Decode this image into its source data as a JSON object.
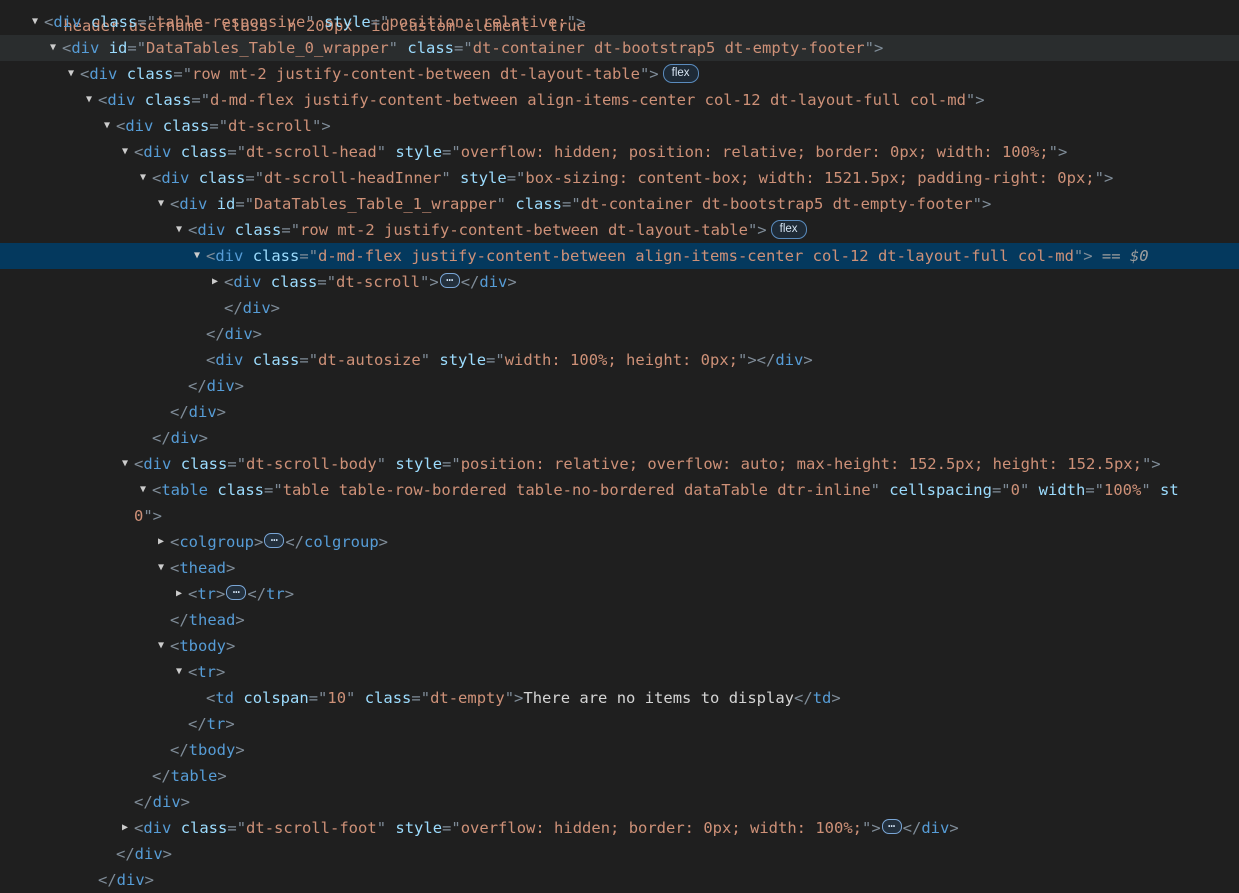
{
  "top_partial": "header.username  class  h 200px  id custom-element  true",
  "selected_marker": "$0",
  "selected_eq": "==",
  "badge_label": "flex",
  "ellipsis_label": "…",
  "lines": [
    {
      "depth": 1,
      "tw": "open",
      "parts": [
        [
          "p",
          "<"
        ],
        [
          "t",
          "div"
        ],
        [
          "sp",
          " "
        ],
        [
          "a",
          "class"
        ],
        [
          "p",
          "=\""
        ],
        [
          "v",
          "table-responsive"
        ],
        [
          "p",
          "\""
        ],
        [
          "sp",
          " "
        ],
        [
          "a",
          "style"
        ],
        [
          "p",
          "=\""
        ],
        [
          "v",
          "position: relative;"
        ],
        [
          "p",
          "\">"
        ]
      ]
    },
    {
      "depth": 2,
      "tw": "open",
      "state": "hover",
      "parts": [
        [
          "p",
          "<"
        ],
        [
          "t",
          "div"
        ],
        [
          "sp",
          " "
        ],
        [
          "a",
          "id"
        ],
        [
          "p",
          "=\""
        ],
        [
          "v",
          "DataTables_Table_0_wrapper"
        ],
        [
          "p",
          "\""
        ],
        [
          "sp",
          " "
        ],
        [
          "a",
          "class"
        ],
        [
          "p",
          "=\""
        ],
        [
          "v",
          "dt-container dt-bootstrap5 dt-empty-footer"
        ],
        [
          "p",
          "\">"
        ]
      ]
    },
    {
      "depth": 3,
      "tw": "open",
      "parts": [
        [
          "p",
          "<"
        ],
        [
          "t",
          "div"
        ],
        [
          "sp",
          " "
        ],
        [
          "a",
          "class"
        ],
        [
          "p",
          "=\""
        ],
        [
          "v",
          "row mt-2 justify-content-between dt-layout-table"
        ],
        [
          "p",
          "\">"
        ],
        [
          "badge",
          "flex"
        ]
      ]
    },
    {
      "depth": 4,
      "tw": "open",
      "parts": [
        [
          "p",
          "<"
        ],
        [
          "t",
          "div"
        ],
        [
          "sp",
          " "
        ],
        [
          "a",
          "class"
        ],
        [
          "p",
          "=\""
        ],
        [
          "v",
          "d-md-flex justify-content-between align-items-center col-12 dt-layout-full col-md"
        ],
        [
          "p",
          "\">"
        ]
      ]
    },
    {
      "depth": 5,
      "tw": "open",
      "parts": [
        [
          "p",
          "<"
        ],
        [
          "t",
          "div"
        ],
        [
          "sp",
          " "
        ],
        [
          "a",
          "class"
        ],
        [
          "p",
          "=\""
        ],
        [
          "v",
          "dt-scroll"
        ],
        [
          "p",
          "\">"
        ]
      ]
    },
    {
      "depth": 6,
      "tw": "open",
      "parts": [
        [
          "p",
          "<"
        ],
        [
          "t",
          "div"
        ],
        [
          "sp",
          " "
        ],
        [
          "a",
          "class"
        ],
        [
          "p",
          "=\""
        ],
        [
          "v",
          "dt-scroll-head"
        ],
        [
          "p",
          "\""
        ],
        [
          "sp",
          " "
        ],
        [
          "a",
          "style"
        ],
        [
          "p",
          "=\""
        ],
        [
          "v",
          "overflow: hidden; position: relative; border: 0px; width: 100%;"
        ],
        [
          "p",
          "\">"
        ]
      ]
    },
    {
      "depth": 7,
      "tw": "open",
      "parts": [
        [
          "p",
          "<"
        ],
        [
          "t",
          "div"
        ],
        [
          "sp",
          " "
        ],
        [
          "a",
          "class"
        ],
        [
          "p",
          "=\""
        ],
        [
          "v",
          "dt-scroll-headInner"
        ],
        [
          "p",
          "\""
        ],
        [
          "sp",
          " "
        ],
        [
          "a",
          "style"
        ],
        [
          "p",
          "=\""
        ],
        [
          "v",
          "box-sizing: content-box; width: 1521.5px; padding-right: 0px;"
        ],
        [
          "p",
          "\">"
        ]
      ]
    },
    {
      "depth": 8,
      "tw": "open",
      "parts": [
        [
          "p",
          "<"
        ],
        [
          "t",
          "div"
        ],
        [
          "sp",
          " "
        ],
        [
          "a",
          "id"
        ],
        [
          "p",
          "=\""
        ],
        [
          "v",
          "DataTables_Table_1_wrapper"
        ],
        [
          "p",
          "\""
        ],
        [
          "sp",
          " "
        ],
        [
          "a",
          "class"
        ],
        [
          "p",
          "=\""
        ],
        [
          "v",
          "dt-container dt-bootstrap5 dt-empty-footer"
        ],
        [
          "p",
          "\">"
        ]
      ]
    },
    {
      "depth": 9,
      "tw": "open",
      "parts": [
        [
          "p",
          "<"
        ],
        [
          "t",
          "div"
        ],
        [
          "sp",
          " "
        ],
        [
          "a",
          "class"
        ],
        [
          "p",
          "=\""
        ],
        [
          "v",
          "row mt-2 justify-content-between dt-layout-table"
        ],
        [
          "p",
          "\">"
        ],
        [
          "badge",
          "flex"
        ]
      ]
    },
    {
      "depth": 10,
      "tw": "open",
      "state": "selected",
      "parts": [
        [
          "p",
          "<"
        ],
        [
          "t",
          "div"
        ],
        [
          "sp",
          " "
        ],
        [
          "a",
          "class"
        ],
        [
          "p",
          "=\""
        ],
        [
          "v",
          "d-md-flex justify-content-between align-items-center col-12 dt-layout-full col-md"
        ],
        [
          "p",
          "\">"
        ],
        [
          "sp",
          " "
        ],
        [
          "eq",
          "=="
        ],
        [
          "sp",
          " "
        ],
        [
          "dollar",
          "$0"
        ]
      ]
    },
    {
      "depth": 11,
      "tw": "closed",
      "parts": [
        [
          "p",
          "<"
        ],
        [
          "t",
          "div"
        ],
        [
          "sp",
          " "
        ],
        [
          "a",
          "class"
        ],
        [
          "p",
          "=\""
        ],
        [
          "v",
          "dt-scroll"
        ],
        [
          "p",
          "\">"
        ],
        [
          "ell",
          "…"
        ],
        [
          "p",
          "</"
        ],
        [
          "t",
          "div"
        ],
        [
          "p",
          ">"
        ]
      ]
    },
    {
      "depth": 11,
      "tw": "none",
      "parts": [
        [
          "p",
          "</"
        ],
        [
          "t",
          "div"
        ],
        [
          "p",
          ">"
        ]
      ]
    },
    {
      "depth": 10,
      "tw": "none",
      "parts": [
        [
          "p",
          "</"
        ],
        [
          "t",
          "div"
        ],
        [
          "p",
          ">"
        ]
      ]
    },
    {
      "depth": 10,
      "tw": "none",
      "parts": [
        [
          "p",
          "<"
        ],
        [
          "t",
          "div"
        ],
        [
          "sp",
          " "
        ],
        [
          "a",
          "class"
        ],
        [
          "p",
          "=\""
        ],
        [
          "v",
          "dt-autosize"
        ],
        [
          "p",
          "\""
        ],
        [
          "sp",
          " "
        ],
        [
          "a",
          "style"
        ],
        [
          "p",
          "=\""
        ],
        [
          "v",
          "width: 100%; height: 0px;"
        ],
        [
          "p",
          "\"></"
        ],
        [
          "t",
          "div"
        ],
        [
          "p",
          ">"
        ]
      ]
    },
    {
      "depth": 9,
      "tw": "none",
      "parts": [
        [
          "p",
          "</"
        ],
        [
          "t",
          "div"
        ],
        [
          "p",
          ">"
        ]
      ]
    },
    {
      "depth": 8,
      "tw": "none",
      "parts": [
        [
          "p",
          "</"
        ],
        [
          "t",
          "div"
        ],
        [
          "p",
          ">"
        ]
      ]
    },
    {
      "depth": 7,
      "tw": "none",
      "parts": [
        [
          "p",
          "</"
        ],
        [
          "t",
          "div"
        ],
        [
          "p",
          ">"
        ]
      ]
    },
    {
      "depth": 6,
      "tw": "open",
      "parts": [
        [
          "p",
          "<"
        ],
        [
          "t",
          "div"
        ],
        [
          "sp",
          " "
        ],
        [
          "a",
          "class"
        ],
        [
          "p",
          "=\""
        ],
        [
          "v",
          "dt-scroll-body"
        ],
        [
          "p",
          "\""
        ],
        [
          "sp",
          " "
        ],
        [
          "a",
          "style"
        ],
        [
          "p",
          "=\""
        ],
        [
          "v",
          "position: relative; overflow: auto; max-height: 152.5px; height: 152.5px;"
        ],
        [
          "p",
          "\">"
        ]
      ]
    },
    {
      "depth": 7,
      "tw": "open",
      "parts": [
        [
          "p",
          "<"
        ],
        [
          "t",
          "table"
        ],
        [
          "sp",
          " "
        ],
        [
          "a",
          "class"
        ],
        [
          "p",
          "=\""
        ],
        [
          "v",
          "table table-row-bordered table-no-bordered dataTable dtr-inline"
        ],
        [
          "p",
          "\""
        ],
        [
          "sp",
          " "
        ],
        [
          "a",
          "cellspacing"
        ],
        [
          "p",
          "=\""
        ],
        [
          "v",
          "0"
        ],
        [
          "p",
          "\""
        ],
        [
          "sp",
          " "
        ],
        [
          "a",
          "width"
        ],
        [
          "p",
          "=\""
        ],
        [
          "v",
          "100%"
        ],
        [
          "p",
          "\""
        ],
        [
          "sp",
          " "
        ],
        [
          "a",
          "st"
        ]
      ]
    },
    {
      "depth": 7,
      "tw": "none",
      "cont": true,
      "parts": [
        [
          "v",
          "0"
        ],
        [
          "p",
          "\">"
        ]
      ]
    },
    {
      "depth": 8,
      "tw": "closed",
      "parts": [
        [
          "p",
          "<"
        ],
        [
          "t",
          "colgroup"
        ],
        [
          "p",
          ">"
        ],
        [
          "ell",
          "…"
        ],
        [
          "p",
          "</"
        ],
        [
          "t",
          "colgroup"
        ],
        [
          "p",
          ">"
        ]
      ]
    },
    {
      "depth": 8,
      "tw": "open",
      "parts": [
        [
          "p",
          "<"
        ],
        [
          "t",
          "thead"
        ],
        [
          "p",
          ">"
        ]
      ]
    },
    {
      "depth": 9,
      "tw": "closed",
      "parts": [
        [
          "p",
          "<"
        ],
        [
          "t",
          "tr"
        ],
        [
          "p",
          ">"
        ],
        [
          "ell",
          "…"
        ],
        [
          "p",
          "</"
        ],
        [
          "t",
          "tr"
        ],
        [
          "p",
          ">"
        ]
      ]
    },
    {
      "depth": 8,
      "tw": "none",
      "parts": [
        [
          "p",
          "</"
        ],
        [
          "t",
          "thead"
        ],
        [
          "p",
          ">"
        ]
      ]
    },
    {
      "depth": 8,
      "tw": "open",
      "parts": [
        [
          "p",
          "<"
        ],
        [
          "t",
          "tbody"
        ],
        [
          "p",
          ">"
        ]
      ]
    },
    {
      "depth": 9,
      "tw": "open",
      "parts": [
        [
          "p",
          "<"
        ],
        [
          "t",
          "tr"
        ],
        [
          "p",
          ">"
        ]
      ]
    },
    {
      "depth": 10,
      "tw": "none",
      "parts": [
        [
          "p",
          "<"
        ],
        [
          "t",
          "td"
        ],
        [
          "sp",
          " "
        ],
        [
          "a",
          "colspan"
        ],
        [
          "p",
          "=\""
        ],
        [
          "v",
          "10"
        ],
        [
          "p",
          "\""
        ],
        [
          "sp",
          " "
        ],
        [
          "a",
          "class"
        ],
        [
          "p",
          "=\""
        ],
        [
          "v",
          "dt-empty"
        ],
        [
          "p",
          "\">"
        ],
        [
          "txt",
          "There are no items to display"
        ],
        [
          "p",
          "</"
        ],
        [
          "t",
          "td"
        ],
        [
          "p",
          ">"
        ]
      ]
    },
    {
      "depth": 9,
      "tw": "none",
      "parts": [
        [
          "p",
          "</"
        ],
        [
          "t",
          "tr"
        ],
        [
          "p",
          ">"
        ]
      ]
    },
    {
      "depth": 8,
      "tw": "none",
      "parts": [
        [
          "p",
          "</"
        ],
        [
          "t",
          "tbody"
        ],
        [
          "p",
          ">"
        ]
      ]
    },
    {
      "depth": 7,
      "tw": "none",
      "parts": [
        [
          "p",
          "</"
        ],
        [
          "t",
          "table"
        ],
        [
          "p",
          ">"
        ]
      ]
    },
    {
      "depth": 6,
      "tw": "none",
      "parts": [
        [
          "p",
          "</"
        ],
        [
          "t",
          "div"
        ],
        [
          "p",
          ">"
        ]
      ]
    },
    {
      "depth": 6,
      "tw": "closed",
      "parts": [
        [
          "p",
          "<"
        ],
        [
          "t",
          "div"
        ],
        [
          "sp",
          " "
        ],
        [
          "a",
          "class"
        ],
        [
          "p",
          "=\""
        ],
        [
          "v",
          "dt-scroll-foot"
        ],
        [
          "p",
          "\""
        ],
        [
          "sp",
          " "
        ],
        [
          "a",
          "style"
        ],
        [
          "p",
          "=\""
        ],
        [
          "v",
          "overflow: hidden; border: 0px; width: 100%;"
        ],
        [
          "p",
          "\">"
        ],
        [
          "ell",
          "…"
        ],
        [
          "p",
          "</"
        ],
        [
          "t",
          "div"
        ],
        [
          "p",
          ">"
        ]
      ]
    },
    {
      "depth": 5,
      "tw": "none",
      "parts": [
        [
          "p",
          "</"
        ],
        [
          "t",
          "div"
        ],
        [
          "p",
          ">"
        ]
      ]
    },
    {
      "depth": 4,
      "tw": "none",
      "parts": [
        [
          "p",
          "</"
        ],
        [
          "t",
          "div"
        ],
        [
          "p",
          ">"
        ]
      ]
    }
  ]
}
